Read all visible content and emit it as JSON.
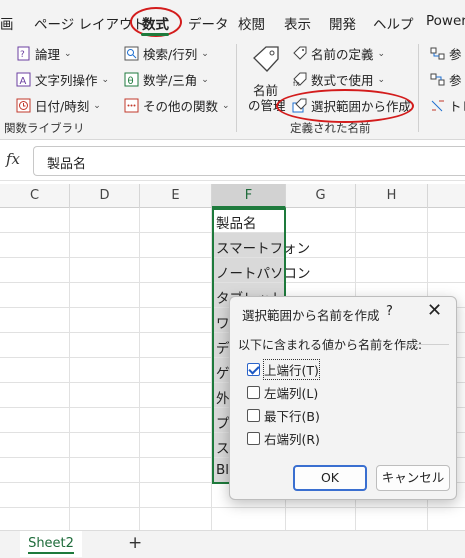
{
  "ribbon_tabs": [
    "画",
    "ページ レイアウト",
    "数式",
    "データ",
    "校閲",
    "表示",
    "開発",
    "ヘルプ",
    "Power"
  ],
  "active_tab": "数式",
  "ribbon": {
    "logical": "論理",
    "text_ops": "文字列操作",
    "datetime": "日付/時刻",
    "lookup": "検索/行列",
    "math": "数学/三角",
    "other": "その他の関数",
    "name_manager_line1": "名前",
    "name_manager_line2": "の管理",
    "define_name": "名前の定義",
    "use_in_formula": "数式で使用",
    "create_from_selection": "選択範囲から作成",
    "ref1": "参",
    "ref2": "参",
    "trace": "トレ",
    "group_function_library": "関数ライブラリ",
    "group_defined_names": "定義された名前"
  },
  "formula_bar": {
    "fx": "fx",
    "value": "製品名"
  },
  "columns": [
    "C",
    "D",
    "E",
    "F",
    "G",
    "H"
  ],
  "active_column": "F",
  "cells_F": [
    "製品名",
    "スマートフォン",
    "ノートパソコン",
    "タブレット",
    "ワ",
    "デ",
    "ゲ",
    "外",
    "プ",
    "ス",
    "Bl"
  ],
  "sheet": {
    "name": "Sheet2",
    "add": "+"
  },
  "dialog": {
    "title": "選択範囲から名前を作成",
    "help": "?",
    "close": "✕",
    "group_label": "以下に含まれる値から名前を作成:",
    "options": [
      {
        "label": "上端行(T)",
        "checked": true
      },
      {
        "label": "左端列(L)",
        "checked": false
      },
      {
        "label": "最下行(B)",
        "checked": false
      },
      {
        "label": "右端列(R)",
        "checked": false
      }
    ],
    "ok": "OK",
    "cancel": "キャンセル"
  },
  "colors": {
    "accent_green": "#1e7a3c",
    "highlight_red": "#d31c1c",
    "focus_blue": "#3a6fd0"
  }
}
